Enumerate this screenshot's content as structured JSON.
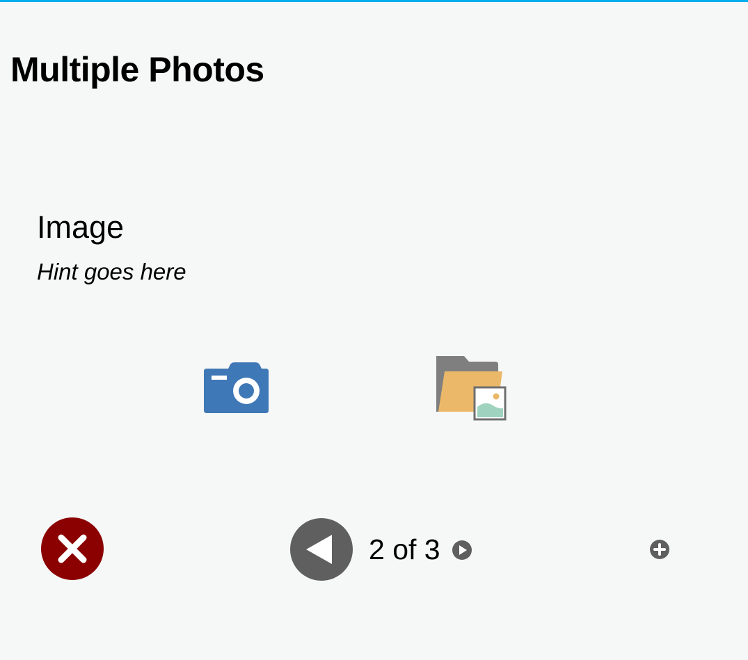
{
  "header": {
    "title": "Multiple Photos",
    "accent_color": "#00aeef"
  },
  "question": {
    "label": "Image",
    "hint": "Hint goes here"
  },
  "capture": {
    "camera_icon": "camera-icon",
    "camera_color": "#3f78b6",
    "gallery_icon": "folder-image-icon",
    "gallery_folder_color": "#ebb86a"
  },
  "pager": {
    "delete_icon": "close-circle-icon",
    "delete_color": "#8b0000",
    "prev_icon": "arrow-left-circle-icon",
    "counter": "2 of 3",
    "next_icon": "play-circle-icon",
    "add_icon": "plus-circle-icon",
    "control_color": "#5f5f5f"
  }
}
